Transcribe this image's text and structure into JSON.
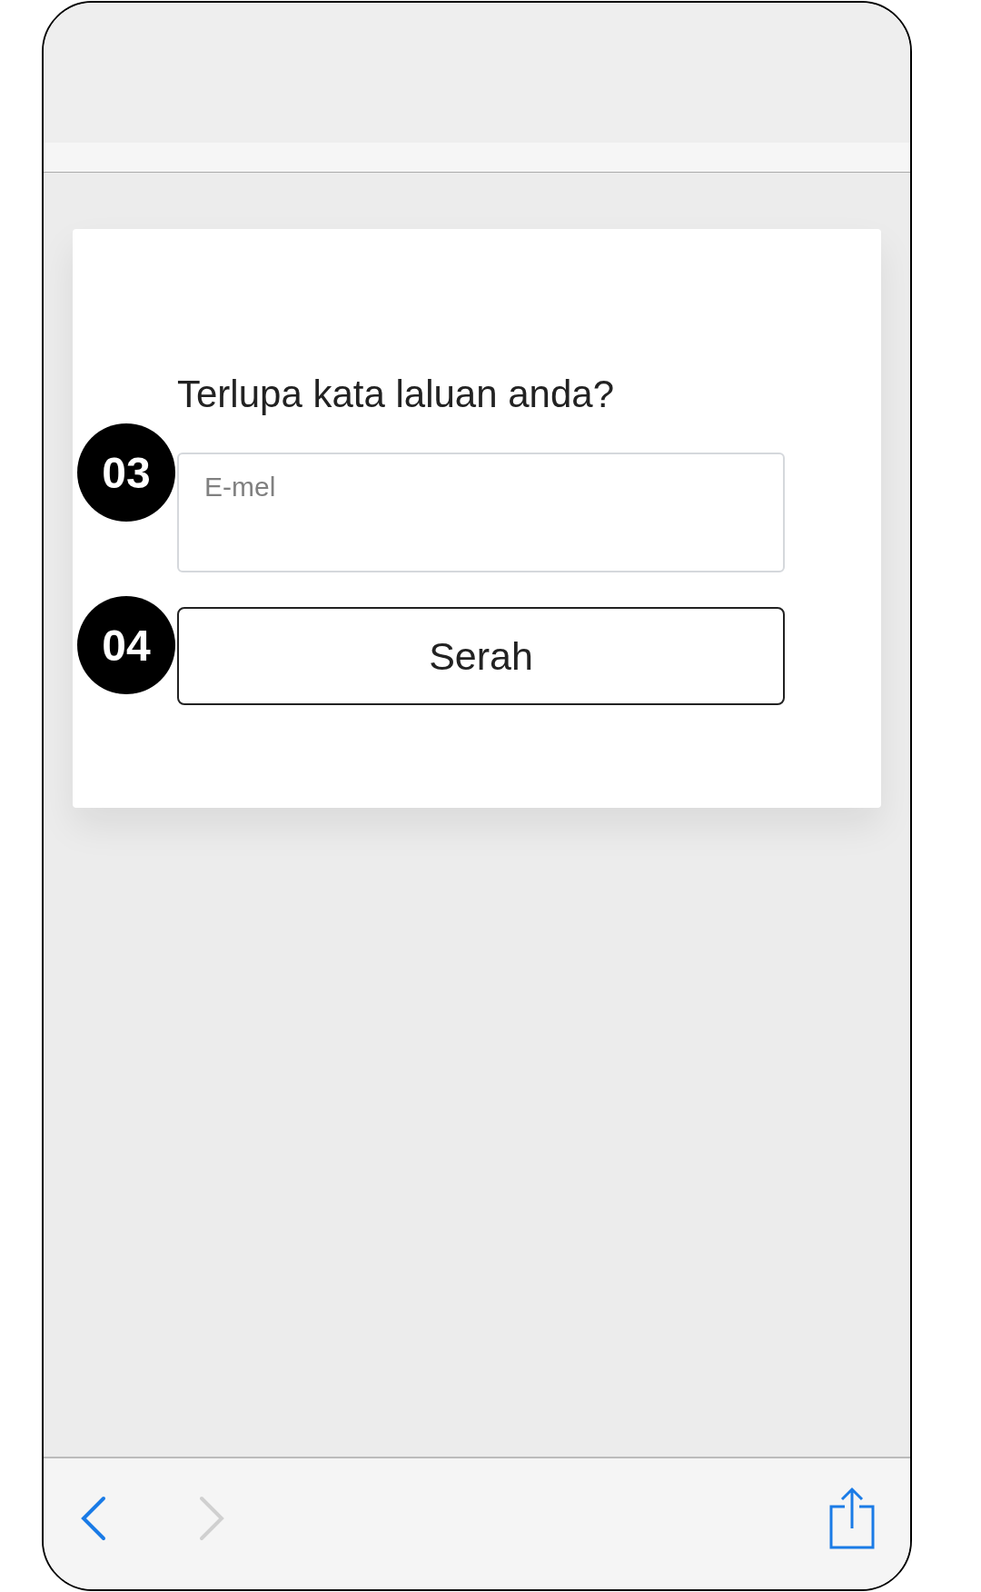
{
  "form": {
    "title": "Terlupa kata laluan anda?",
    "email_field": {
      "placeholder": "E-mel",
      "step": "03"
    },
    "submit_button": {
      "label": "Serah",
      "step": "04"
    }
  },
  "toolbar": {
    "back": {
      "disabled": false
    },
    "forward": {
      "disabled": true
    }
  }
}
